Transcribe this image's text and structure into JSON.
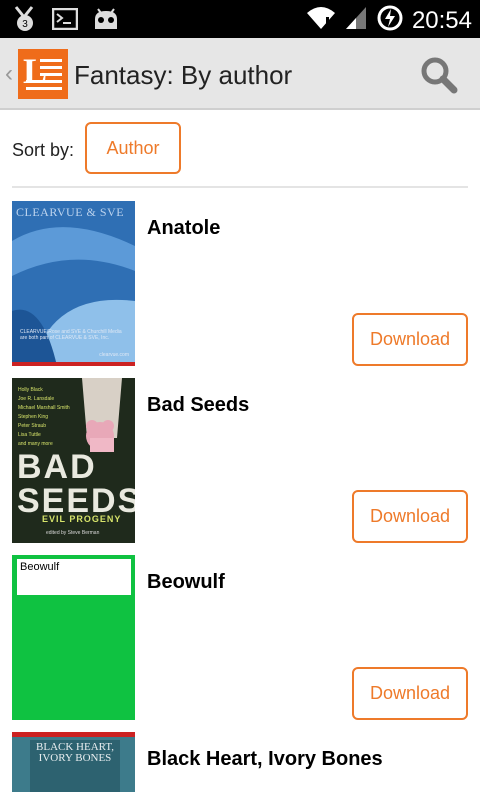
{
  "status_bar": {
    "time": "20:54",
    "notification_count": "3",
    "icons": [
      "usb-debug-icon",
      "terminal-icon",
      "android-icon",
      "wifi-icon",
      "signal-icon",
      "battery-charging-icon"
    ]
  },
  "action_bar": {
    "title": "Fantasy: By author",
    "logo_letter": "L",
    "search_icon": "search-icon"
  },
  "sort": {
    "label": "Sort by:",
    "value": "Author"
  },
  "books": [
    {
      "title": "Anatole",
      "download_label": "Download",
      "cover": {
        "publisher": "CLEARVUE & SVE",
        "text": "CLEARVUE/Rose and SVE & Churchill Media are both part of CLEARVUE & SVE, Inc.",
        "footer": "clearvue.com"
      }
    },
    {
      "title": "Bad Seeds",
      "download_label": "Download",
      "cover": {
        "authors": [
          "Holly Black",
          "Joe R. Lansdale",
          "Michael Marshall Smith",
          "Stephen King",
          "Peter Straub",
          "Lisa Tuttle",
          "and many more"
        ],
        "big": "BAD SEEDS",
        "sub": "EVIL PROGENY",
        "editor": "edited by Steve Berman"
      }
    },
    {
      "title": "Beowulf",
      "download_label": "Download",
      "cover": {
        "label": "Beowulf"
      }
    },
    {
      "title": "Black Heart, Ivory Bones",
      "download_label": "",
      "cover": {
        "title": "BLACK HEART, IVORY BONES"
      }
    }
  ],
  "colors": {
    "accent": "#ee7a2a",
    "action_bar": "#e6e6e6",
    "status_bar": "#000000"
  }
}
